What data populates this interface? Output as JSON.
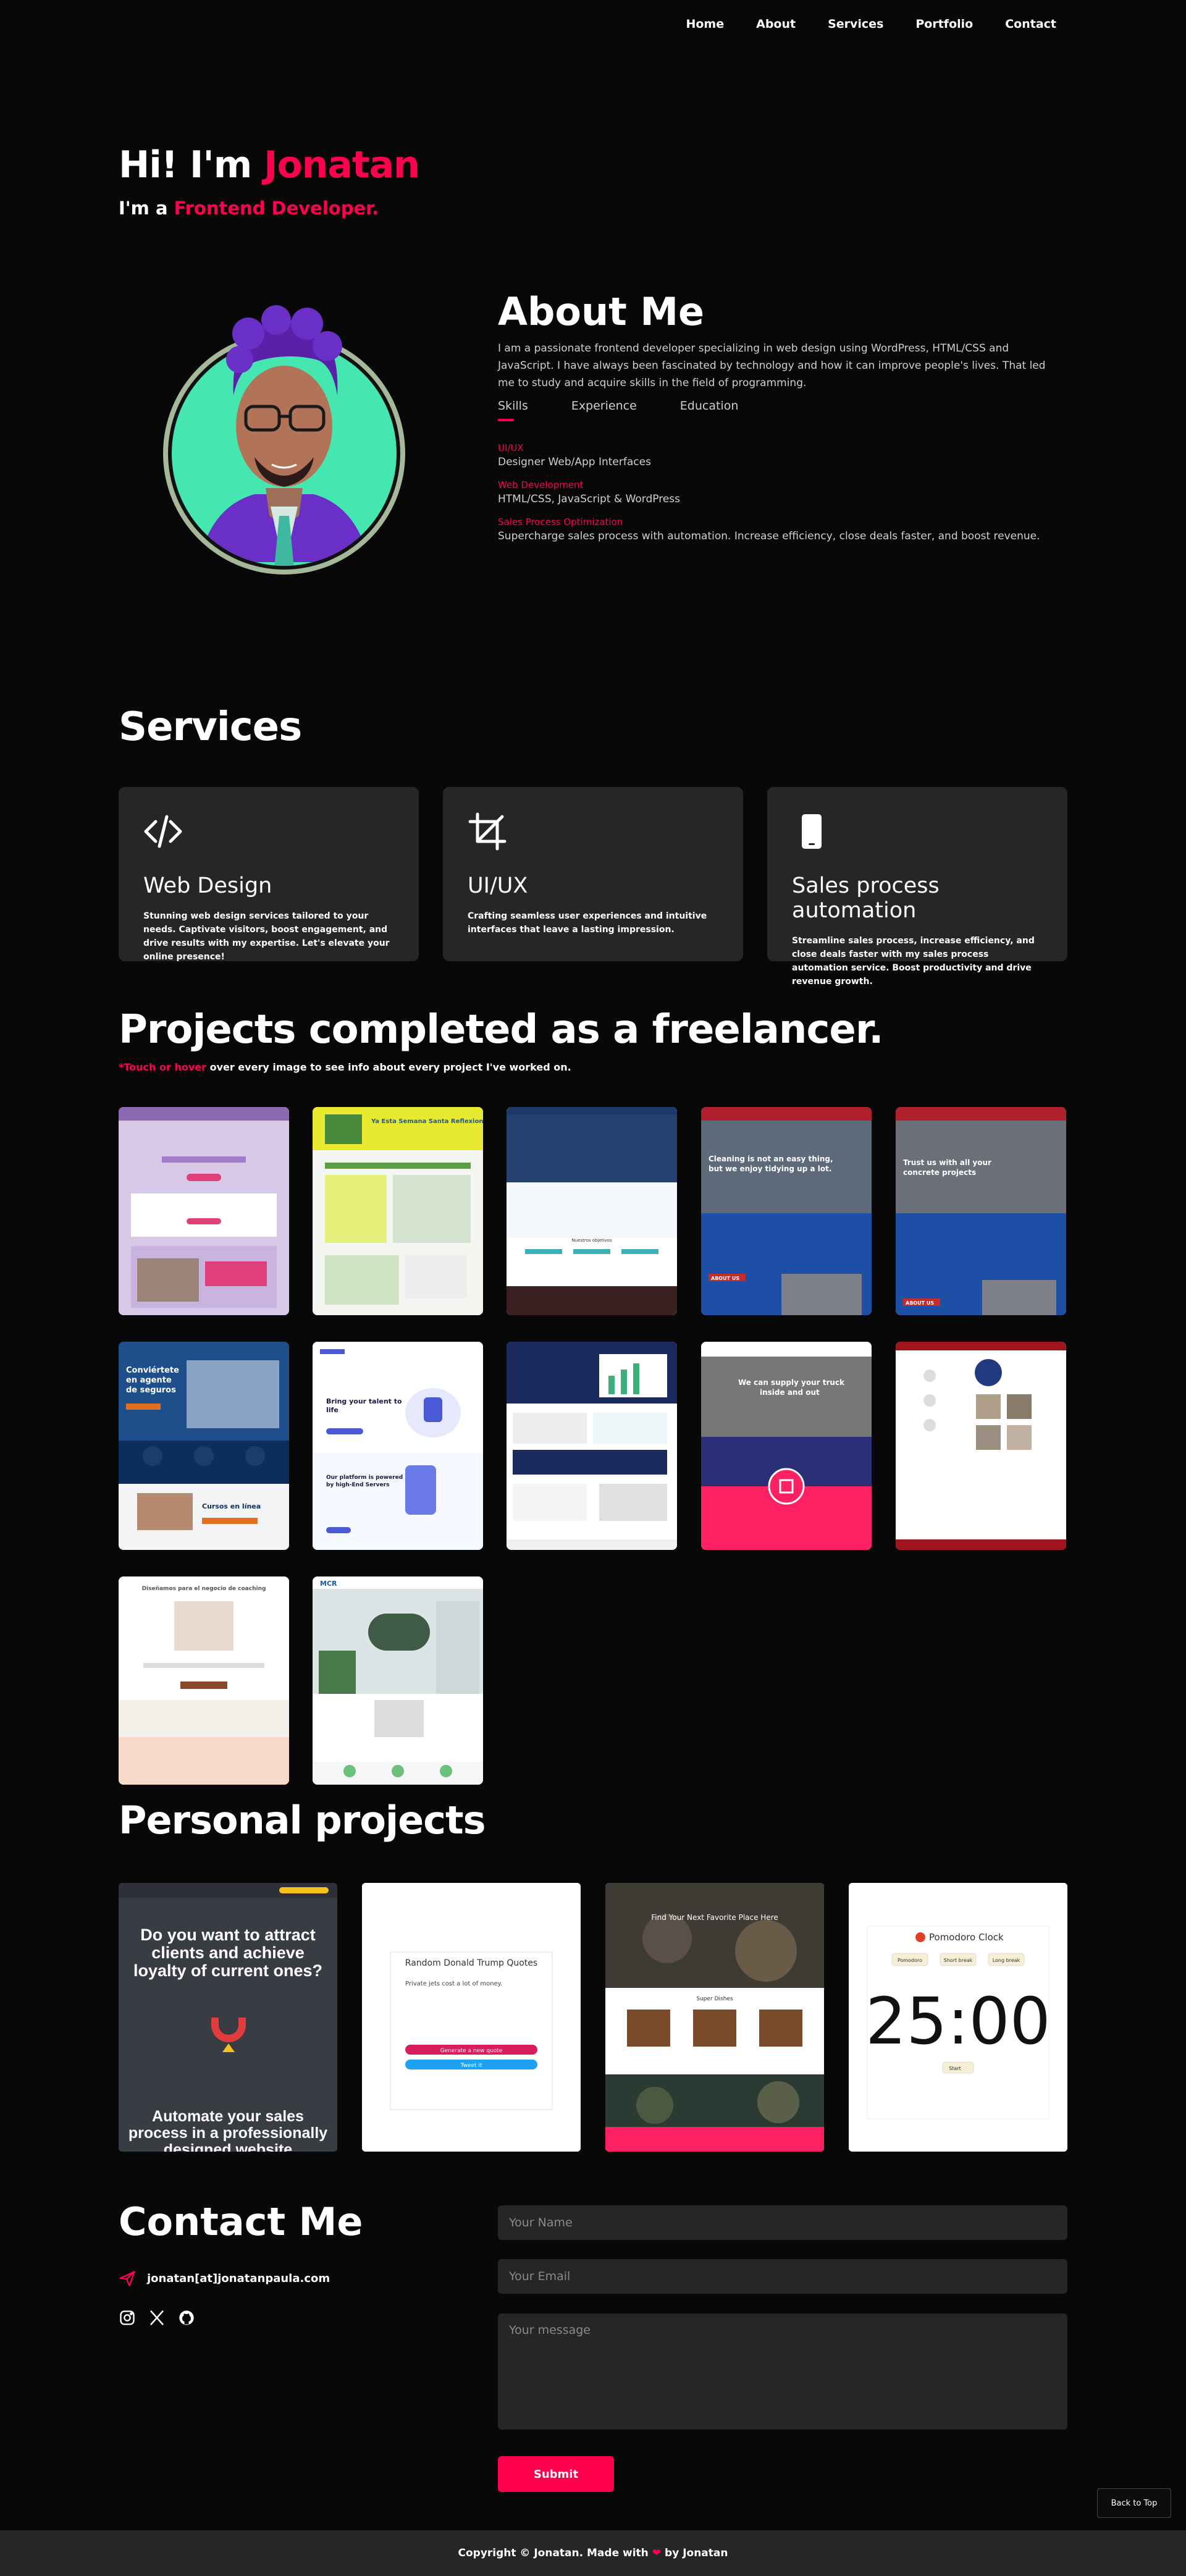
{
  "nav": {
    "items": [
      "Home",
      "About",
      "Services",
      "Portfolio",
      "Contact"
    ]
  },
  "hero": {
    "greeting": "Hi! I'm ",
    "name": "Jonatan",
    "role_prefix": "I'm a ",
    "role": "Frontend Developer."
  },
  "about": {
    "title": "About Me",
    "text": "I am a passionate frontend developer specializing in web design using WordPress, HTML/CSS and JavaScript. I have always been fascinated by technology and how it can improve people's lives. That led me to study and acquire skills in the field of programming.",
    "tabs": [
      "Skills",
      "Experience",
      "Education"
    ],
    "skills": [
      {
        "title": "UI/UX",
        "desc": "Designer Web/App Interfaces"
      },
      {
        "title": "Web Development",
        "desc": "HTML/CSS, JavaScript & WordPress"
      },
      {
        "title": "Sales Process Optimization",
        "desc": "Supercharge sales process with automation. Increase efficiency, close deals faster, and boost revenue."
      }
    ]
  },
  "services": {
    "title": "Services",
    "cards": [
      {
        "icon": "code-icon",
        "title": "Web Design",
        "desc": "Stunning web design services tailored to your needs. Captivate visitors, boost engagement, and drive results with my expertise. Let's elevate your online presence!"
      },
      {
        "icon": "crop-icon",
        "title": "UI/UX",
        "desc": "Crafting seamless user experiences and intuitive interfaces that leave a lasting impression."
      },
      {
        "icon": "mobile-icon",
        "title": "Sales process automation",
        "desc": "Streamline sales process, increase efficiency, and close deals faster with my sales process automation service. Boost productivity and drive revenue growth."
      }
    ]
  },
  "projects": {
    "title": "Projects completed as a freelancer.",
    "note_star": "*",
    "note_action": "Touch or hover",
    "note_rest": " over every image to see info about every project I've worked on."
  },
  "freelance_thumbs": [
    {
      "heading": "",
      "body": ""
    },
    {
      "heading": "Ya Esta Semana Santa Reflexiona en familia",
      "body": ""
    },
    {
      "heading": "",
      "body": "Nuestros objetivos"
    },
    {
      "heading": "Cleaning is not an easy thing, but we enjoy tidying up a lot.",
      "body": "ABOUT US"
    },
    {
      "heading": "Trust us with all your concrete projects",
      "body": "ABOUT US"
    },
    {
      "heading": "Conviértete en agente de seguros",
      "body": "Cursos en línea"
    },
    {
      "heading": "Bring your talent to life",
      "body": "Our platform is powered by high-End Servers"
    },
    {
      "heading": "",
      "body": ""
    },
    {
      "heading": "We can supply your truck inside and out",
      "body": ""
    },
    {
      "heading": "",
      "body": ""
    },
    {
      "heading": "Diseñamos para el negocio de coaching",
      "body": ""
    },
    {
      "heading": "MCR",
      "body": ""
    }
  ],
  "personal": {
    "title": "Personal projects",
    "items": [
      {
        "heading": "Do you want to attract clients and achieve loyalty of current ones?",
        "footer": "Automate your sales process in a professionally designed website"
      },
      {
        "heading": "Random Donald Trump Quotes",
        "quote": "Private jets cost a lot of money.",
        "btn1": "Generate a new quote",
        "btn2": "Tweet it"
      },
      {
        "heading": "Find Your Next Favorite Place Here",
        "section": "Super Dishes"
      },
      {
        "heading": "Pomodoro Clock",
        "tabs": [
          "Pomodoro",
          "Short break",
          "Long break"
        ],
        "time": "25:00",
        "start": "Start"
      }
    ]
  },
  "contact": {
    "title": "Contact Me",
    "email": "jonatan[at]jonatanpaula.com",
    "socials": [
      "instagram-icon",
      "x-icon",
      "github-icon"
    ],
    "name_placeholder": "Your Name",
    "email_placeholder": "Your Email",
    "message_placeholder": "Your message",
    "submit": "Submit"
  },
  "back_to_top": "Back to Top",
  "footer": {
    "prefix": "Copyright © Jonatan. Made with ",
    "suffix": " by Jonatan"
  },
  "colors": {
    "accent": "#ff004f",
    "card": "#262626",
    "bg": "#080808"
  }
}
